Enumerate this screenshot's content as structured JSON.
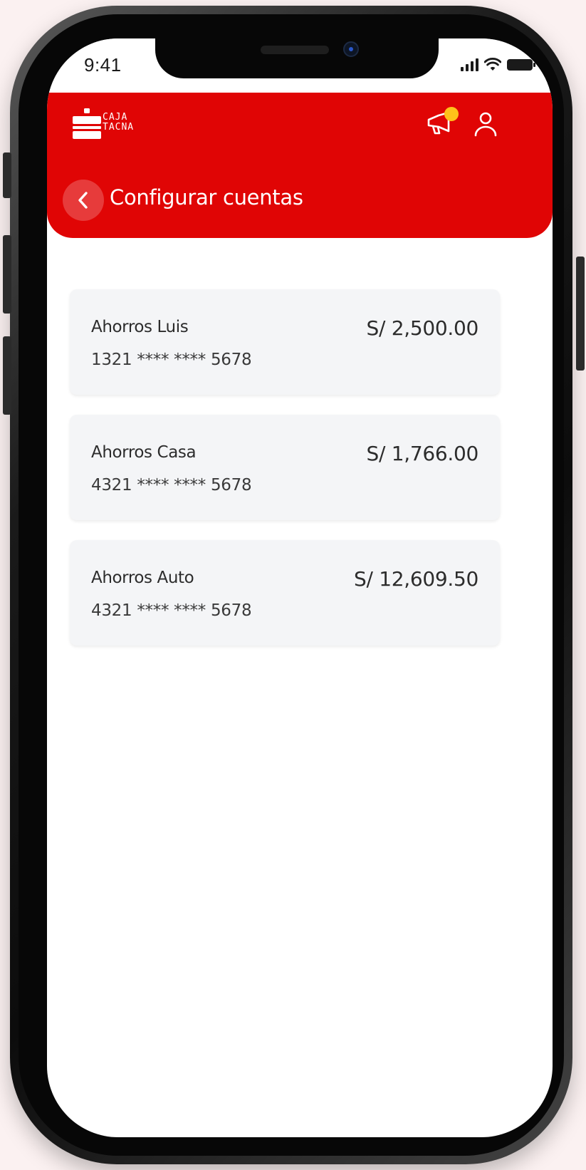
{
  "status_bar": {
    "time": "9:41",
    "icons": [
      "cellular-signal-icon",
      "wifi-icon",
      "battery-icon"
    ]
  },
  "header": {
    "logo_text_line1": "CAJA",
    "logo_text_line2": "TACNA",
    "notification_icon": "megaphone-icon",
    "profile_icon": "user-icon",
    "back_icon": "chevron-left-icon",
    "title": "Configurar cuentas"
  },
  "accounts": [
    {
      "name": "Ahorros Luis",
      "number": "1321 **** **** 5678",
      "balance": "S/ 2,500.00"
    },
    {
      "name": "Ahorros Casa",
      "number": "4321 **** **** 5678",
      "balance": "S/ 1,766.00"
    },
    {
      "name": "Ahorros Auto",
      "number": "4321 **** **** 5678",
      "balance": "S/ 12,609.50"
    }
  ],
  "colors": {
    "brand_red": "#e00505",
    "notification_badge": "#ffc21a",
    "card_background": "#f4f5f7"
  }
}
